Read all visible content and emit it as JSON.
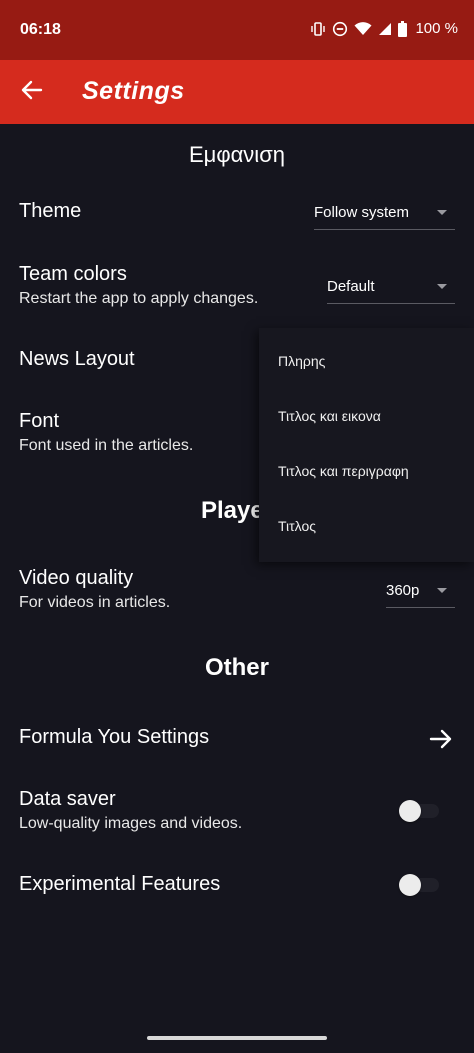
{
  "status_bar": {
    "time": "06:18",
    "battery": "100 %",
    "icons": [
      "vibrate-icon",
      "do-not-disturb-icon",
      "wifi-icon",
      "signal-icon",
      "battery-icon"
    ]
  },
  "app_bar": {
    "back_icon": "back-arrow-icon",
    "title": "Settings"
  },
  "sections": {
    "appearance": "Εμφανιση",
    "player": "Player",
    "other": "Other"
  },
  "settings": {
    "theme": {
      "title": "Theme",
      "value": "Follow system"
    },
    "team_colors": {
      "title": "Team colors",
      "subtitle": "Restart the app to apply changes.",
      "value": "Default"
    },
    "news_layout": {
      "title": "News Layout"
    },
    "font": {
      "title": "Font",
      "subtitle": "Font used in the articles."
    },
    "video_quality": {
      "title": "Video quality",
      "subtitle": "For videos in articles.",
      "value": "360p"
    },
    "formula_you": {
      "title": "Formula You Settings",
      "icon": "arrow-right-icon"
    },
    "data_saver": {
      "title": "Data saver",
      "subtitle": "Low-quality images and videos.",
      "enabled": false
    },
    "experimental": {
      "title": "Experimental Features",
      "enabled": false
    }
  },
  "news_layout_menu": {
    "options": [
      "Πληρης",
      "Τιτλος και εικονα",
      "Τιτλος και περιγραφη",
      "Τιτλος"
    ]
  },
  "colors": {
    "background": "#15151e",
    "status_bar": "#971b13",
    "app_bar": "#d52b1e",
    "menu_background": "#17171f"
  }
}
